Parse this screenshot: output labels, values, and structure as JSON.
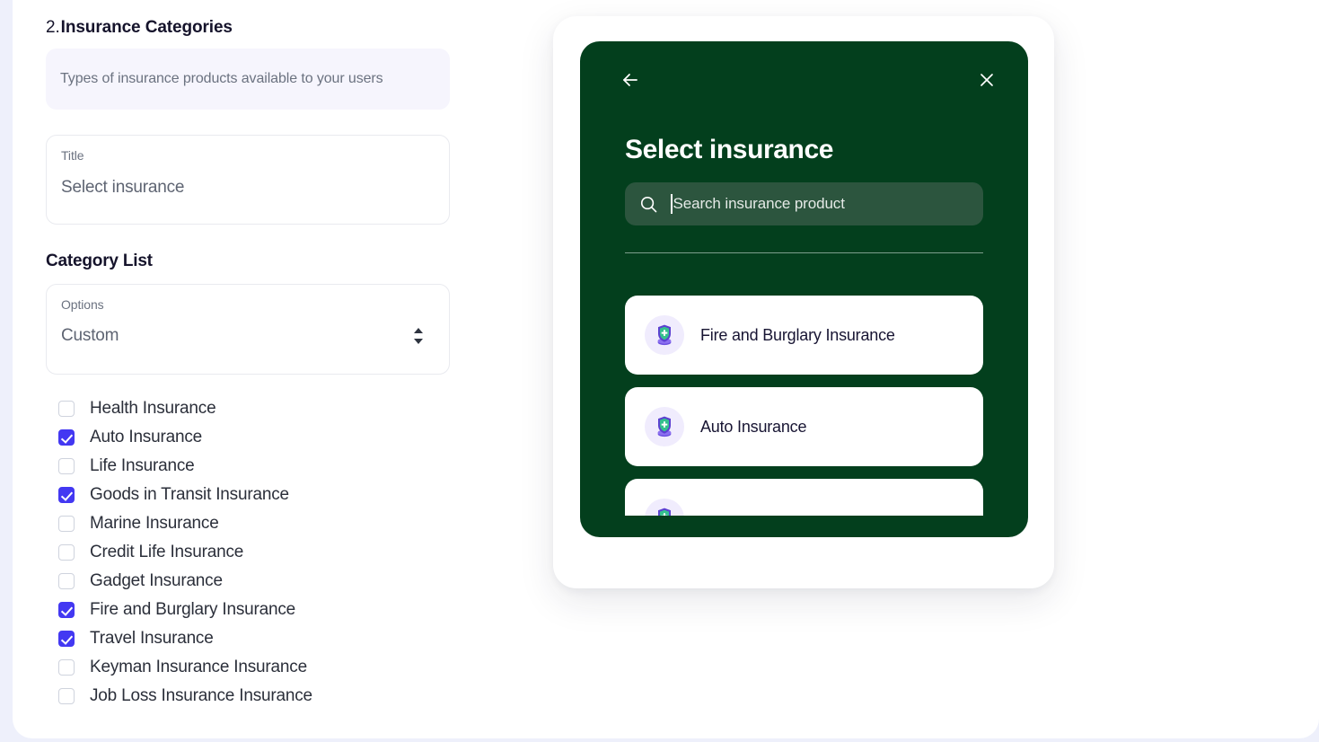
{
  "theme": {
    "page_background": "#eef0fb",
    "panel_background": "#ffffff",
    "checkbox_accent": "#4338f2",
    "preview_green": "#033f1d",
    "search_field_green": "#2c553e",
    "description_box": "#f6f5fd",
    "icon_circle": "#f0ecfd"
  },
  "form": {
    "section_number": "2.",
    "section_title": "Insurance Categories",
    "description": "Types of insurance products available to your users",
    "title_field": {
      "label": "Title",
      "value": "Select insurance",
      "placeholder": "Title"
    },
    "category_list_heading": "Category List",
    "options_field": {
      "label": "Options",
      "value": "Custom",
      "options": [
        "Custom"
      ]
    },
    "categories": [
      {
        "label": "Health Insurance",
        "checked": false
      },
      {
        "label": "Auto Insurance",
        "checked": true
      },
      {
        "label": "Life Insurance",
        "checked": false
      },
      {
        "label": "Goods in Transit Insurance",
        "checked": true
      },
      {
        "label": "Marine Insurance",
        "checked": false
      },
      {
        "label": "Credit Life Insurance",
        "checked": false
      },
      {
        "label": "Gadget Insurance",
        "checked": false
      },
      {
        "label": "Fire and Burglary Insurance",
        "checked": true
      },
      {
        "label": "Travel Insurance",
        "checked": true
      },
      {
        "label": "Keyman Insurance Insurance",
        "checked": false
      },
      {
        "label": "Job Loss Insurance Insurance",
        "checked": false
      }
    ]
  },
  "preview": {
    "back_icon": "arrow-left-icon",
    "close_icon": "close-icon",
    "title": "Select insurance",
    "search": {
      "icon": "search-icon",
      "placeholder": "Search insurance product",
      "value": ""
    },
    "results": [
      {
        "label": "Fire and Burglary Insurance",
        "icon": "shield-insurance-icon"
      },
      {
        "label": "Auto Insurance",
        "icon": "shield-insurance-icon"
      },
      {
        "label": "",
        "icon": "shield-insurance-icon"
      }
    ]
  }
}
